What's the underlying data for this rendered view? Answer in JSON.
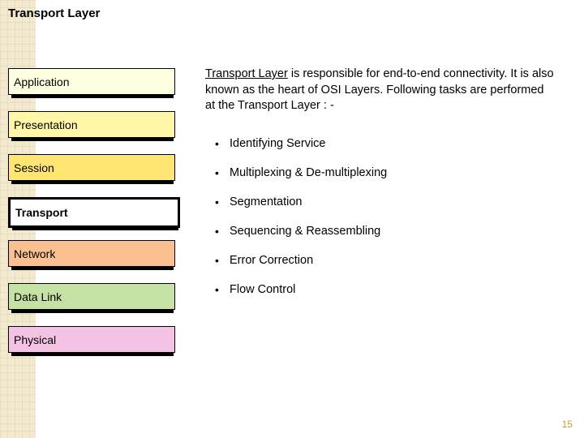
{
  "title": "Transport Layer",
  "layers": [
    {
      "label": "Application"
    },
    {
      "label": "Presentation"
    },
    {
      "label": "Session"
    },
    {
      "label": "Transport"
    },
    {
      "label": "Network"
    },
    {
      "label": "Data Link"
    },
    {
      "label": "Physical"
    }
  ],
  "intro": {
    "underlined": "Transport Layer",
    "rest": "  is         responsible for end-to-end connectivity. It is also known as  the heart of  OSI  Layers. Following tasks are performed at the Transport Layer : -"
  },
  "tasks": [
    "Identifying Service",
    "Multiplexing & De-multiplexing",
    "Segmentation",
    "Sequencing & Reassembling",
    "Error Correction",
    "Flow Control"
  ],
  "page_number": "15"
}
